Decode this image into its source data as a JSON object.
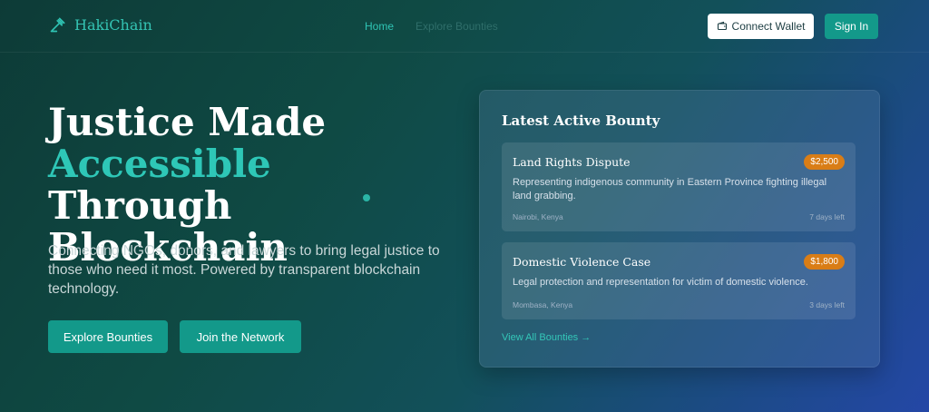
{
  "nav": {
    "brand": "HakiChain",
    "links": [
      {
        "label": "Home"
      },
      {
        "label": "Explore Bounties"
      }
    ],
    "connect_wallet": "Connect Wallet",
    "sign_in": "Sign In"
  },
  "hero": {
    "title_line1": "Justice Made",
    "title_accent": "Accessible",
    "title_rest": "Through",
    "title_line3": "Blockchain",
    "subtitle": "Connecting NGOs, donors, and lawyers to bring legal justice to those who need it most. Powered by transparent blockchain technology.",
    "cta_explore": "Explore Bounties",
    "cta_join": "Join the Network"
  },
  "bounty_card": {
    "heading": "Latest Active Bounty",
    "bounties": [
      {
        "title": "Land Rights Dispute",
        "amount": "$2,500",
        "description": "Representing indigenous community in Eastern Province fighting illegal land grabbing.",
        "location": "Nairobi, Kenya",
        "time_left": "7 days left"
      },
      {
        "title": "Domestic Violence Case",
        "amount": "$1,800",
        "description": "Legal protection and representation for victim of domestic violence.",
        "location": "Mombasa, Kenya",
        "time_left": "3 days left"
      }
    ],
    "view_all": "View All Bounties →"
  },
  "colors": {
    "accent": "#2ec7b7",
    "button": "#13998a",
    "amount_badge": "#d97d16"
  }
}
